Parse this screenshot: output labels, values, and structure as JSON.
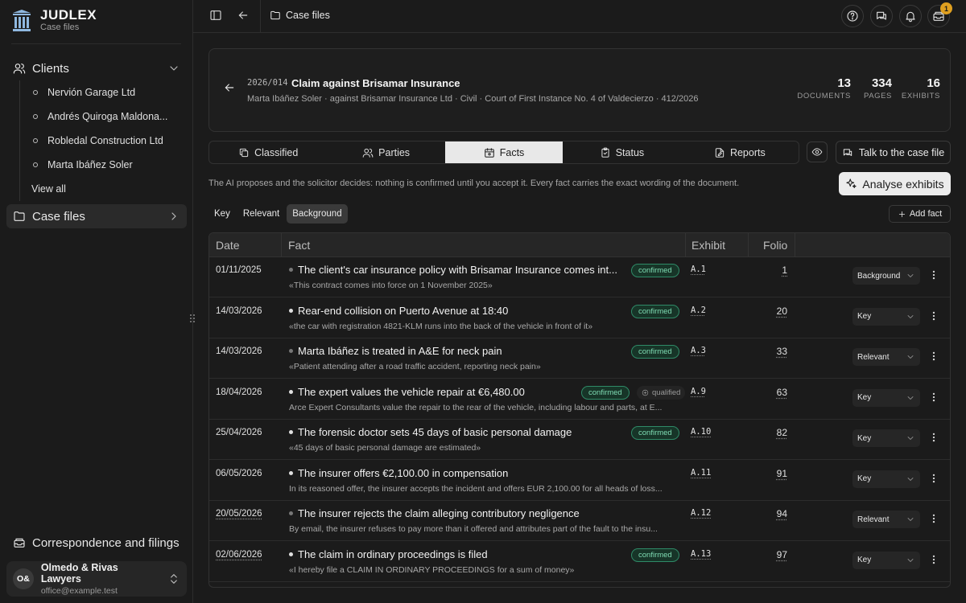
{
  "brand": {
    "name": "JUDLEX",
    "subtitle": "Case files"
  },
  "sidebar": {
    "clients_label": "Clients",
    "clients": [
      "Nervión Garage Ltd",
      "Andrés Quiroga Maldona...",
      "Robledal Construction Ltd",
      "Marta Ibáñez Soler"
    ],
    "view_all": "View all",
    "case_files_label": "Case files",
    "correspondence_label": "Correspondence and filings",
    "user": {
      "initials": "O&",
      "name": "Olmedo & Rivas Lawyers",
      "email": "office@example.test"
    }
  },
  "topbar": {
    "breadcrumb": "Case files",
    "notifications_count": "1"
  },
  "case": {
    "ref": "2026/014",
    "title": "Claim against Brisamar Insurance",
    "meta": "Marta Ibáñez Soler · against Brisamar Insurance Ltd · Civil · Court of First Instance No. 4 of Valdecierzo · 412/2026",
    "stats": [
      {
        "value": "13",
        "label": "DOCUMENTS"
      },
      {
        "value": "334",
        "label": "PAGES"
      },
      {
        "value": "16",
        "label": "EXHIBITS"
      }
    ]
  },
  "tabs": [
    {
      "label": "Classified",
      "icon": "copy-icon"
    },
    {
      "label": "Parties",
      "icon": "users-icon"
    },
    {
      "label": "Facts",
      "icon": "calendar-icon",
      "active": true
    },
    {
      "label": "Status",
      "icon": "clipboard-icon"
    },
    {
      "label": "Reports",
      "icon": "report-icon"
    }
  ],
  "talk_button": "Talk to the case file",
  "info_text": "The AI proposes and the solicitor decides: nothing is confirmed until you accept it. Every fact carries the exact wording of the document.",
  "analyse_button": "Analyse exhibits",
  "filters": [
    {
      "label": "Key"
    },
    {
      "label": "Relevant"
    },
    {
      "label": "Background",
      "active": true
    }
  ],
  "add_fact_button": "Add fact",
  "table": {
    "headers": {
      "date": "Date",
      "fact": "Fact",
      "exhibit": "Exhibit",
      "folio": "Folio"
    },
    "rows": [
      {
        "date": "01/11/2025",
        "title": "The client's car insurance policy with Brisamar Insurance comes int...",
        "quote": "«This contract comes into force on 1 November 2025»",
        "status": "confirmed",
        "exhibit": "A.1",
        "folio": "1",
        "classification": "Background",
        "dim": true
      },
      {
        "date": "14/03/2026",
        "title": "Rear-end collision on Puerto Avenue at 18:40",
        "quote": "«the car with registration 4821-KLM runs into the back of the vehicle in front of it»",
        "status": "confirmed",
        "exhibit": "A.2",
        "folio": "20",
        "classification": "Key"
      },
      {
        "date": "14/03/2026",
        "title": "Marta Ibáñez is treated in A&E for neck pain",
        "quote": "«Patient attending after a road traffic accident, reporting neck pain»",
        "status": "confirmed",
        "exhibit": "A.3",
        "folio": "33",
        "classification": "Relevant",
        "dim": true
      },
      {
        "date": "18/04/2026",
        "title": "The expert values the vehicle repair at €6,480.00",
        "quote": "Arce Expert Consultants value the repair to the rear of the vehicle, including labour and parts, at E...",
        "status": "confirmed",
        "qualified": "qualified",
        "exhibit": "A.9",
        "folio": "63",
        "classification": "Key"
      },
      {
        "date": "25/04/2026",
        "title": "The forensic doctor sets 45 days of basic personal damage",
        "quote": "«45 days of basic personal damage are estimated»",
        "status": "confirmed",
        "exhibit": "A.10",
        "folio": "82",
        "classification": "Key"
      },
      {
        "date": "06/05/2026",
        "title": "The insurer offers €2,100.00 in compensation",
        "quote": "In its reasoned offer, the insurer accepts the incident and offers EUR 2,100.00 for all heads of loss...",
        "exhibit": "A.11",
        "folio": "91",
        "classification": "Key"
      },
      {
        "date": "20/05/2026",
        "title": "The insurer rejects the claim alleging contributory negligence",
        "quote": "By email, the insurer refuses to pay more than it offered and attributes part of the fault to the insu...",
        "exhibit": "A.12",
        "folio": "94",
        "classification": "Relevant",
        "dim": true,
        "date_underline": true
      },
      {
        "date": "02/06/2026",
        "title": "The claim in ordinary proceedings is filed",
        "quote": "«I hereby file a CLAIM IN ORDINARY PROCEEDINGS for a sum of money»",
        "status": "confirmed",
        "exhibit": "A.13",
        "folio": "97",
        "classification": "Key",
        "date_underline": true
      }
    ]
  }
}
